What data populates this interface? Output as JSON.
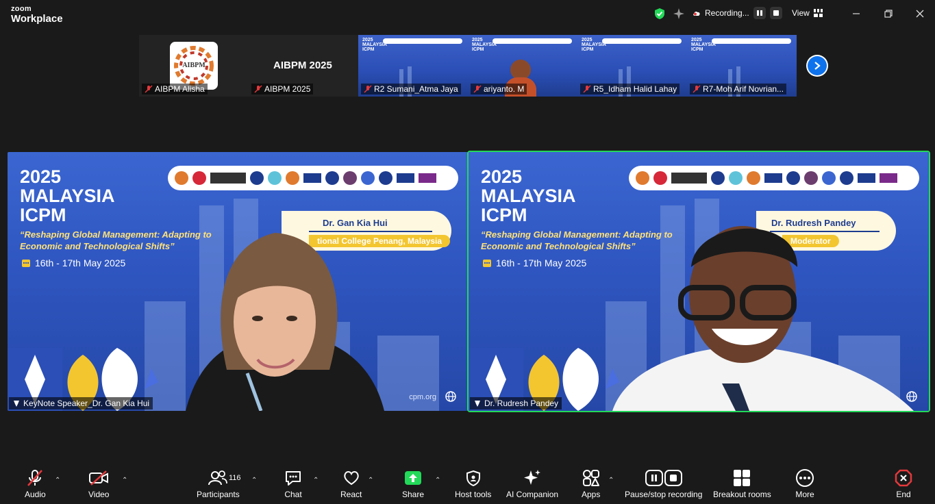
{
  "app": {
    "brand_top": "zoom",
    "brand_bottom": "Workplace"
  },
  "titlebar": {
    "recording_label": "Recording...",
    "view_label": "View"
  },
  "strip": {
    "tiles": [
      {
        "name": "AIBPM Alisha",
        "logo_text": "AIBPM"
      },
      {
        "name": "AIBPM 2025",
        "center_text": "AIBPM 2025"
      },
      {
        "name": "R2 Sumani_Atma Jaya"
      },
      {
        "name": "ariyanto. M"
      },
      {
        "name": "R5_Idham Halid Lahay"
      },
      {
        "name": "R7-Moh Arif Novrian..."
      }
    ],
    "mini_year": "2025",
    "mini_country": "MALAYSIA",
    "mini_event": "ICPM"
  },
  "videos": [
    {
      "participant": "KeyNote Speaker_Dr. Gan Kia Hui",
      "banner_year": "2025",
      "banner_country": "MALAYSIA",
      "banner_event": "ICPM",
      "banner_subtitle": "“Reshaping Global Management: Adapting to Economic and Technological Shifts”",
      "banner_date": "16th - 17th May 2025",
      "card_name": "Dr. Gan Kia Hui",
      "card_role": "tional College Penang, Malaysia",
      "url": "cpm.org"
    },
    {
      "participant": "Dr. Rudresh Pandey",
      "banner_year": "2025",
      "banner_country": "MALAYSIA",
      "banner_event": "ICPM",
      "banner_subtitle": "“Reshaping Global Management: Adapting to Economic and Technological Shifts”",
      "banner_date": "16th - 17th May 2025",
      "card_name": "Dr. Rudresh Pandey",
      "card_role": "Moderator"
    }
  ],
  "toolbar": {
    "audio": "Audio",
    "video": "Video",
    "participants": "Participants",
    "participants_count": "116",
    "chat": "Chat",
    "react": "React",
    "share": "Share",
    "host_tools": "Host tools",
    "ai_companion": "AI Companion",
    "apps": "Apps",
    "pause_recording": "Pause/stop recording",
    "breakout": "Breakout rooms",
    "more": "More",
    "end": "End"
  },
  "colors": {
    "active_speaker": "#23d959",
    "share_green": "#23d959",
    "end_red": "#e5383b",
    "accent_blue": "#0e72ed"
  }
}
